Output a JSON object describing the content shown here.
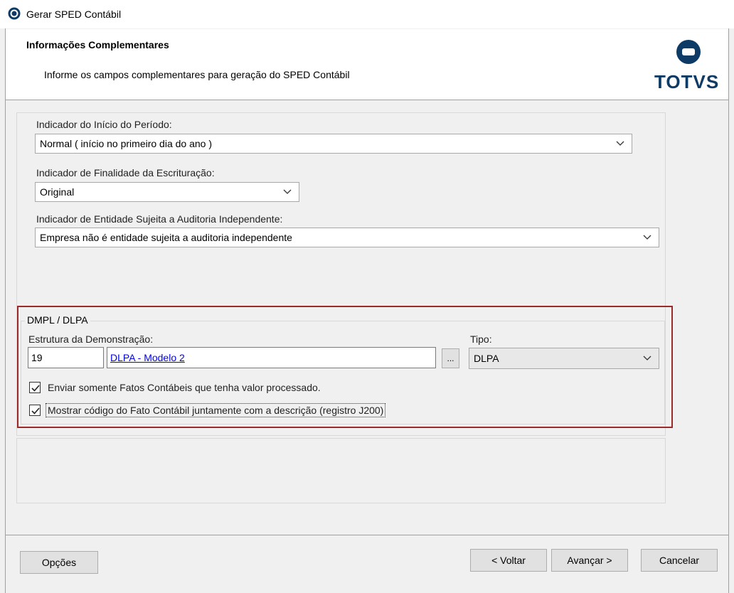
{
  "window": {
    "title": "Gerar SPED Contábil"
  },
  "header": {
    "heading": "Informações Complementares",
    "subheading": "Informe os campos complementares para geração do SPED Contábil",
    "logo_text": "TOTVS"
  },
  "form": {
    "periodo": {
      "label": "Indicador do Início do Período:",
      "value": "Normal ( início no primeiro dia do ano )"
    },
    "finalidade": {
      "label": "Indicador de Finalidade da Escrituração:",
      "value": "Original"
    },
    "auditoria": {
      "label": "Indicador de Entidade Sujeita a Auditoria Independente:",
      "value": "Empresa não é entidade sujeita a auditoria independente"
    }
  },
  "dmpl": {
    "group_title": "DMPL / DLPA",
    "estrutura_label": "Estrutura da Demonstração:",
    "estrutura_code": "19",
    "estrutura_desc": "DLPA - Modelo 2",
    "lookup_label": "...",
    "tipo_label": "Tipo:",
    "tipo_value": "DLPA",
    "check1": {
      "label": "Enviar somente Fatos Contábeis que tenha valor processado.",
      "checked": true
    },
    "check2": {
      "label": "Mostrar código do Fato Contábil juntamente com a descrição (registro J200)",
      "checked": true
    }
  },
  "footer": {
    "opcoes": "Opções",
    "voltar": "< Voltar",
    "avancar": "Avançar >",
    "cancelar": "Cancelar"
  },
  "colors": {
    "highlight": "#9b2b2b",
    "link": "#0000ee",
    "logo": "#0d3b66"
  }
}
